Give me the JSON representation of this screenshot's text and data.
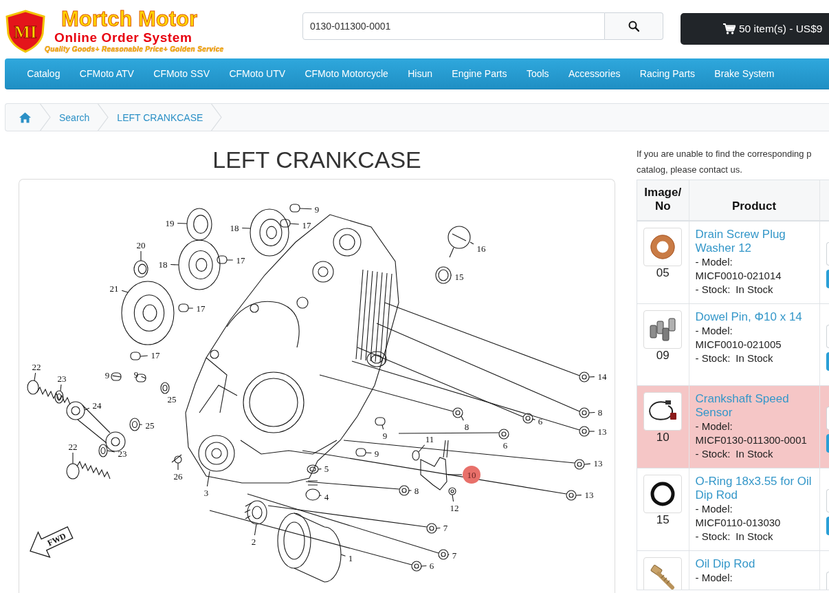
{
  "header": {
    "logo": {
      "initials": "MI",
      "name": "Mortch Motor",
      "subtitle": "Online Order System",
      "slogan": "Quality Goods+ Reasonable Price+ Golden Service"
    },
    "search": {
      "value": "0130-011300-0001"
    },
    "cart": {
      "label": "50 item(s) - US$9"
    }
  },
  "nav": {
    "items": [
      "Catalog",
      "CFMoto ATV",
      "CFMoto SSV",
      "CFMoto UTV",
      "CFMoto Motorcycle",
      "Hisun",
      "Engine Parts",
      "Tools",
      "Accessories",
      "Racing Parts",
      "Brake System"
    ]
  },
  "breadcrumb": {
    "items": [
      "Search",
      "LEFT CRANKCASE"
    ]
  },
  "title": "LEFT CRANKCASE",
  "diagram": {
    "direction_label": "FWD",
    "callouts": [
      {
        "label": "9",
        "selected": false
      },
      {
        "label": "19",
        "selected": false
      },
      {
        "label": "18",
        "selected": false
      },
      {
        "label": "17",
        "selected": false
      },
      {
        "label": "20",
        "selected": false
      },
      {
        "label": "16",
        "selected": false
      },
      {
        "label": "18",
        "selected": false
      },
      {
        "label": "17",
        "selected": false
      },
      {
        "label": "15",
        "selected": false
      },
      {
        "label": "21",
        "selected": false
      },
      {
        "label": "17",
        "selected": false
      },
      {
        "label": "17",
        "selected": false
      },
      {
        "label": "22",
        "selected": false
      },
      {
        "label": "23",
        "selected": false
      },
      {
        "label": "9",
        "selected": false
      },
      {
        "label": "9",
        "selected": false
      },
      {
        "label": "14",
        "selected": false
      },
      {
        "label": "24",
        "selected": false
      },
      {
        "label": "25",
        "selected": false
      },
      {
        "label": "8",
        "selected": false
      },
      {
        "label": "25",
        "selected": false
      },
      {
        "label": "8",
        "selected": false
      },
      {
        "label": "6",
        "selected": false
      },
      {
        "label": "9",
        "selected": false
      },
      {
        "label": "11",
        "selected": false
      },
      {
        "label": "13",
        "selected": false
      },
      {
        "label": "22",
        "selected": false
      },
      {
        "label": "23",
        "selected": false
      },
      {
        "label": "9",
        "selected": false
      },
      {
        "label": "6",
        "selected": false
      },
      {
        "label": "13",
        "selected": false
      },
      {
        "label": "26",
        "selected": false
      },
      {
        "label": "5",
        "selected": false
      },
      {
        "label": "10",
        "selected": true
      },
      {
        "label": "3",
        "selected": false
      },
      {
        "label": "4",
        "selected": false
      },
      {
        "label": "8",
        "selected": false
      },
      {
        "label": "13",
        "selected": false
      },
      {
        "label": "12",
        "selected": false
      },
      {
        "label": "7",
        "selected": false
      },
      {
        "label": "2",
        "selected": false
      },
      {
        "label": "1",
        "selected": false
      },
      {
        "label": "6",
        "selected": false
      },
      {
        "label": "7",
        "selected": false
      }
    ]
  },
  "parts_panel": {
    "notice": [
      "If you are unable to find the corresponding p",
      "catalog, please contact us."
    ],
    "table": {
      "columns": [
        "Image/ No",
        "Product"
      ],
      "rows": [
        {
          "no": "05",
          "name": "Drain Screw Plug Washer 12",
          "model_label": "- Model:",
          "model": "MICF0010-021014",
          "stock_label": "- Stock:",
          "stock": "In Stock",
          "selected": false
        },
        {
          "no": "09",
          "name": "Dowel Pin, Φ10 x 14",
          "model_label": "- Model:",
          "model": "MICF0010-021005",
          "stock_label": "- Stock:",
          "stock": "In Stock",
          "selected": false
        },
        {
          "no": "10",
          "name": "Crankshaft Speed Sensor",
          "model_label": "- Model:",
          "model": "MICF0130-011300-0001",
          "stock_label": "- Stock:",
          "stock": "In Stock",
          "selected": true
        },
        {
          "no": "15",
          "name": "O-Ring 18x3.55 for Oil Dip Rod",
          "model_label": "- Model:",
          "model": "MICF0110-013030",
          "stock_label": "- Stock:",
          "stock": "In Stock",
          "selected": false
        },
        {
          "name": "Oil Dip Rod",
          "model_label": "- Model:",
          "selected": false
        }
      ]
    }
  }
}
